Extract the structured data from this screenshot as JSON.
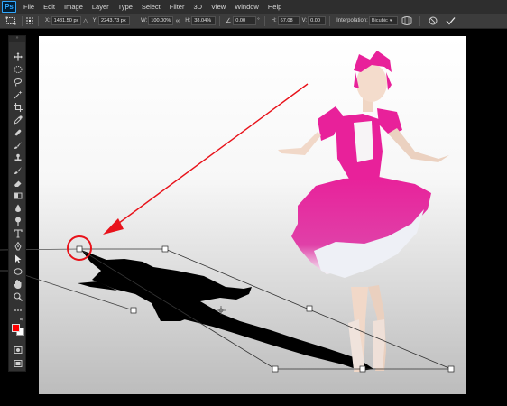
{
  "app": {
    "logo": "Ps"
  },
  "menu": [
    "File",
    "Edit",
    "Image",
    "Layer",
    "Type",
    "Select",
    "Filter",
    "3D",
    "View",
    "Window",
    "Help"
  ],
  "options": {
    "x_label": "X:",
    "x_value": "1481.50 px",
    "y_label": "Y:",
    "y_value": "2243.73 px",
    "w_label": "W:",
    "w_value": "100.00%",
    "h_label": "H:",
    "h_value": "38.04%",
    "angle_value": "0.00",
    "hskew_label": "H:",
    "hskew_value": "67.08",
    "vskew_label": "V:",
    "vskew_value": "0.00",
    "interp_label": "Interpolation:",
    "interp_value": "Bicubic"
  },
  "icons": {
    "move": "move-icon",
    "marquee": "marquee-icon",
    "lasso": "lasso-icon",
    "wand": "magic-wand-icon",
    "crop": "crop-icon",
    "eyedropper": "eyedropper-icon",
    "healing": "healing-brush-icon",
    "brush": "brush-icon",
    "stamp": "clone-stamp-icon",
    "history": "history-brush-icon",
    "eraser": "eraser-icon",
    "gradient": "gradient-icon",
    "blur": "blur-icon",
    "dodge": "dodge-icon",
    "pen": "pen-icon",
    "type": "type-tool-icon",
    "path": "path-selection-icon",
    "shape": "ellipse-icon",
    "hand": "hand-icon",
    "zoom": "zoom-icon"
  },
  "colors": {
    "accent": "#31a8ff",
    "foreground": "#ff0000",
    "background": "#ffffff",
    "annotation": "#e8121a",
    "costume": "#e8219a"
  }
}
